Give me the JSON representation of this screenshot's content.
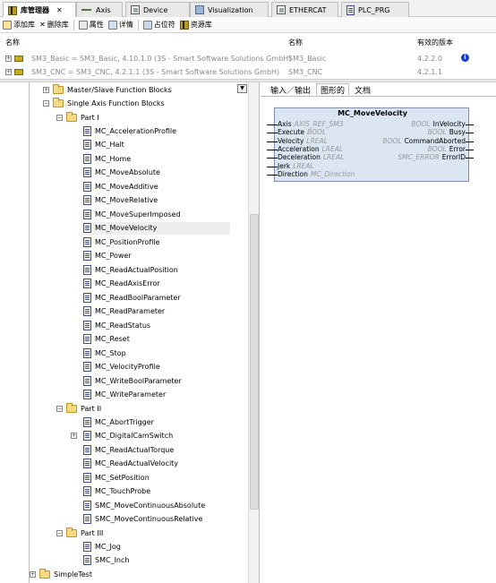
{
  "tabs": [
    {
      "label": "库管理器",
      "active": true,
      "closable": true,
      "icon": "library-icon"
    },
    {
      "label": "Axis",
      "icon": "axis-icon"
    },
    {
      "label": "Device",
      "icon": "device-icon"
    },
    {
      "label": "Visualization",
      "icon": "visualization-icon"
    },
    {
      "label": "ETHERCAT",
      "icon": "device-icon"
    },
    {
      "label": "PLC_PRG",
      "icon": "document-icon"
    }
  ],
  "toolbar": {
    "add_library": "添加库",
    "delete_library": "删除库",
    "properties": "属性",
    "details": "详情",
    "placeholder": "占位符",
    "repository": "资源库"
  },
  "libraries": {
    "headers": {
      "name": "名称",
      "namespace": "名称",
      "effective_version": "有效的版本"
    },
    "rows": [
      {
        "name": "SM3_Basic = SM3_Basic, 4.10.1.0 (3S - Smart Software Solutions GmbH)",
        "namespace": "SM3_Basic",
        "version": "4.2.2.0",
        "info": "i"
      },
      {
        "name": "SM3_CNC = SM3_CNC, 4.2.1.1 (3S - Smart Software Solutions GmbH)",
        "namespace": "SM3_CNC",
        "version": "4.2.1.1"
      }
    ]
  },
  "tree": {
    "master_slave": "Master/Slave Function Blocks",
    "single_axis": "Single Axis Function Blocks",
    "part1": "Part I",
    "part1_items": [
      "MC_AccelerationProfile",
      "MC_Halt",
      "MC_Home",
      "MC_MoveAbsolute",
      "MC_MoveAdditive",
      "MC_MoveRelative",
      "MC_MoveSuperImposed",
      "MC_MoveVelocity",
      "MC_PositionProfile",
      "MC_Power",
      "MC_ReadActualPosition",
      "MC_ReadAxisError",
      "MC_ReadBoolParameter",
      "MC_ReadParameter",
      "MC_ReadStatus",
      "MC_Reset",
      "MC_Stop",
      "MC_VelocityProfile",
      "MC_WriteBoolParameter",
      "MC_WriteParameter"
    ],
    "part2": "Part II",
    "part2_items": [
      "MC_AbortTrigger",
      "MC_DigitalCamSwitch",
      "MC_ReadActualTorque",
      "MC_ReadActualVelocity",
      "MC_SetPosition",
      "MC_TouchProbe",
      "SMC_MoveContinuousAbsolute",
      "SMC_MoveContinuousRelative"
    ],
    "part3": "Part III",
    "part3_items": [
      "MC_Jog",
      "SMC_Inch"
    ],
    "simple_test": "SimpleTest",
    "selected": "MC_MoveVelocity"
  },
  "detail_tabs": [
    "输入／输出",
    "图形的",
    "文档"
  ],
  "function_block": {
    "title": "MC_MoveVelocity",
    "inputs": [
      {
        "name": "Axis",
        "type": "AXIS_REF_SM3"
      },
      {
        "name": "Execute",
        "type": "BOOL"
      },
      {
        "name": "Velocity",
        "type": "LREAL"
      },
      {
        "name": "Acceleration",
        "type": "LREAL"
      },
      {
        "name": "Deceleration",
        "type": "LREAL"
      },
      {
        "name": "Jerk",
        "type": "LREAL"
      },
      {
        "name": "Direction",
        "type": "MC_Direction"
      }
    ],
    "outputs": [
      {
        "name": "InVelocity",
        "type": "BOOL"
      },
      {
        "name": "Busy",
        "type": "BOOL"
      },
      {
        "name": "CommandAborted",
        "type": "BOOL"
      },
      {
        "name": "Error",
        "type": "BOOL"
      },
      {
        "name": "ErrorID",
        "type": "SMC_ERROR"
      }
    ]
  },
  "colors": {
    "block_fill": "#dbe6f2",
    "folder": "#f4da84",
    "info_icon": "#1a3fd0"
  }
}
